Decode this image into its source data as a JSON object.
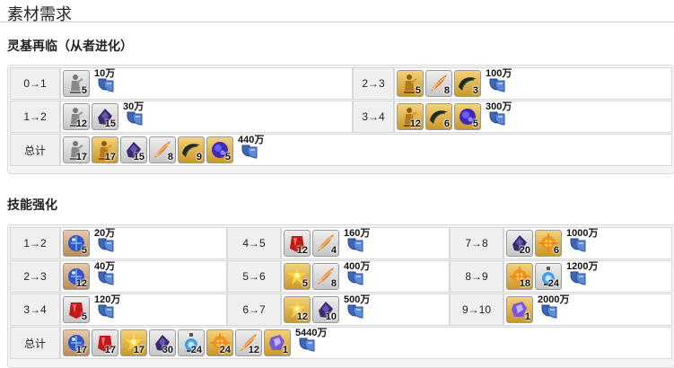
{
  "page_title": "素材需求",
  "ascension": {
    "heading": "灵基再临（从者进化）",
    "rows": [
      {
        "label": "0→1",
        "items": [
          {
            "icon": "silver-statue-icon",
            "count": "5"
          }
        ],
        "qp": "10万"
      },
      {
        "label": "2→3",
        "items": [
          {
            "icon": "gold-statue-icon",
            "count": "5"
          },
          {
            "icon": "phoenix-feather-icon",
            "count": "8"
          },
          {
            "icon": "dragon-fang-icon",
            "count": "3"
          }
        ],
        "qp": "100万"
      },
      {
        "label": "1→2",
        "items": [
          {
            "icon": "silver-statue-icon",
            "count": "12"
          },
          {
            "icon": "void-dust-icon",
            "count": "15"
          }
        ],
        "qp": "30万"
      },
      {
        "label": "3→4",
        "items": [
          {
            "icon": "gold-statue-icon",
            "count": "12"
          },
          {
            "icon": "dragon-fang-icon",
            "count": "6"
          },
          {
            "icon": "heart-of-foreign-god-icon",
            "count": "5"
          }
        ],
        "qp": "300万"
      }
    ],
    "total": {
      "label": "总计",
      "items": [
        {
          "icon": "silver-statue-icon",
          "count": "17"
        },
        {
          "icon": "gold-statue-icon",
          "count": "17"
        },
        {
          "icon": "void-dust-icon",
          "count": "15"
        },
        {
          "icon": "phoenix-feather-icon",
          "count": "8"
        },
        {
          "icon": "dragon-fang-icon",
          "count": "9"
        },
        {
          "icon": "heart-of-foreign-god-icon",
          "count": "5"
        }
      ],
      "qp": "440万"
    }
  },
  "skills": {
    "heading": "技能强化",
    "rows": [
      {
        "label": "1→2",
        "items": [
          {
            "icon": "blue-gem-icon",
            "count": "5"
          }
        ],
        "qp": "20万"
      },
      {
        "label": "4→5",
        "items": [
          {
            "icon": "red-gem-icon",
            "count": "12"
          },
          {
            "icon": "phoenix-feather-icon",
            "count": "4"
          }
        ],
        "qp": "160万"
      },
      {
        "label": "7→8",
        "items": [
          {
            "icon": "void-dust-icon",
            "count": "20"
          },
          {
            "icon": "star-shard-icon",
            "count": "6"
          }
        ],
        "qp": "1000万"
      },
      {
        "label": "2→3",
        "items": [
          {
            "icon": "blue-gem-icon",
            "count": "12"
          }
        ],
        "qp": "40万"
      },
      {
        "label": "5→6",
        "items": [
          {
            "icon": "gold-piece-icon",
            "count": "5"
          },
          {
            "icon": "phoenix-feather-icon",
            "count": "8"
          }
        ],
        "qp": "400万"
      },
      {
        "label": "8→9",
        "items": [
          {
            "icon": "star-shard-icon",
            "count": "18"
          },
          {
            "icon": "ghost-lantern-icon",
            "count": "24"
          }
        ],
        "qp": "1200万"
      },
      {
        "label": "3→4",
        "items": [
          {
            "icon": "red-gem-icon",
            "count": "5"
          }
        ],
        "qp": "120万"
      },
      {
        "label": "6→7",
        "items": [
          {
            "icon": "gold-piece-icon",
            "count": "12"
          },
          {
            "icon": "void-dust-icon",
            "count": "10"
          }
        ],
        "qp": "500万"
      },
      {
        "label": "9→10",
        "items": [
          {
            "icon": "crystal-icon",
            "count": "1"
          }
        ],
        "qp": "2000万"
      }
    ],
    "total": {
      "label": "总计",
      "items": [
        {
          "icon": "blue-gem-icon",
          "count": "17"
        },
        {
          "icon": "red-gem-icon",
          "count": "17"
        },
        {
          "icon": "gold-piece-icon",
          "count": "17"
        },
        {
          "icon": "void-dust-icon",
          "count": "30"
        },
        {
          "icon": "ghost-lantern-icon",
          "count": "24"
        },
        {
          "icon": "star-shard-icon",
          "count": "24"
        },
        {
          "icon": "phoenix-feather-icon",
          "count": "12"
        },
        {
          "icon": "crystal-icon",
          "count": "1"
        }
      ],
      "qp": "5440万"
    }
  }
}
